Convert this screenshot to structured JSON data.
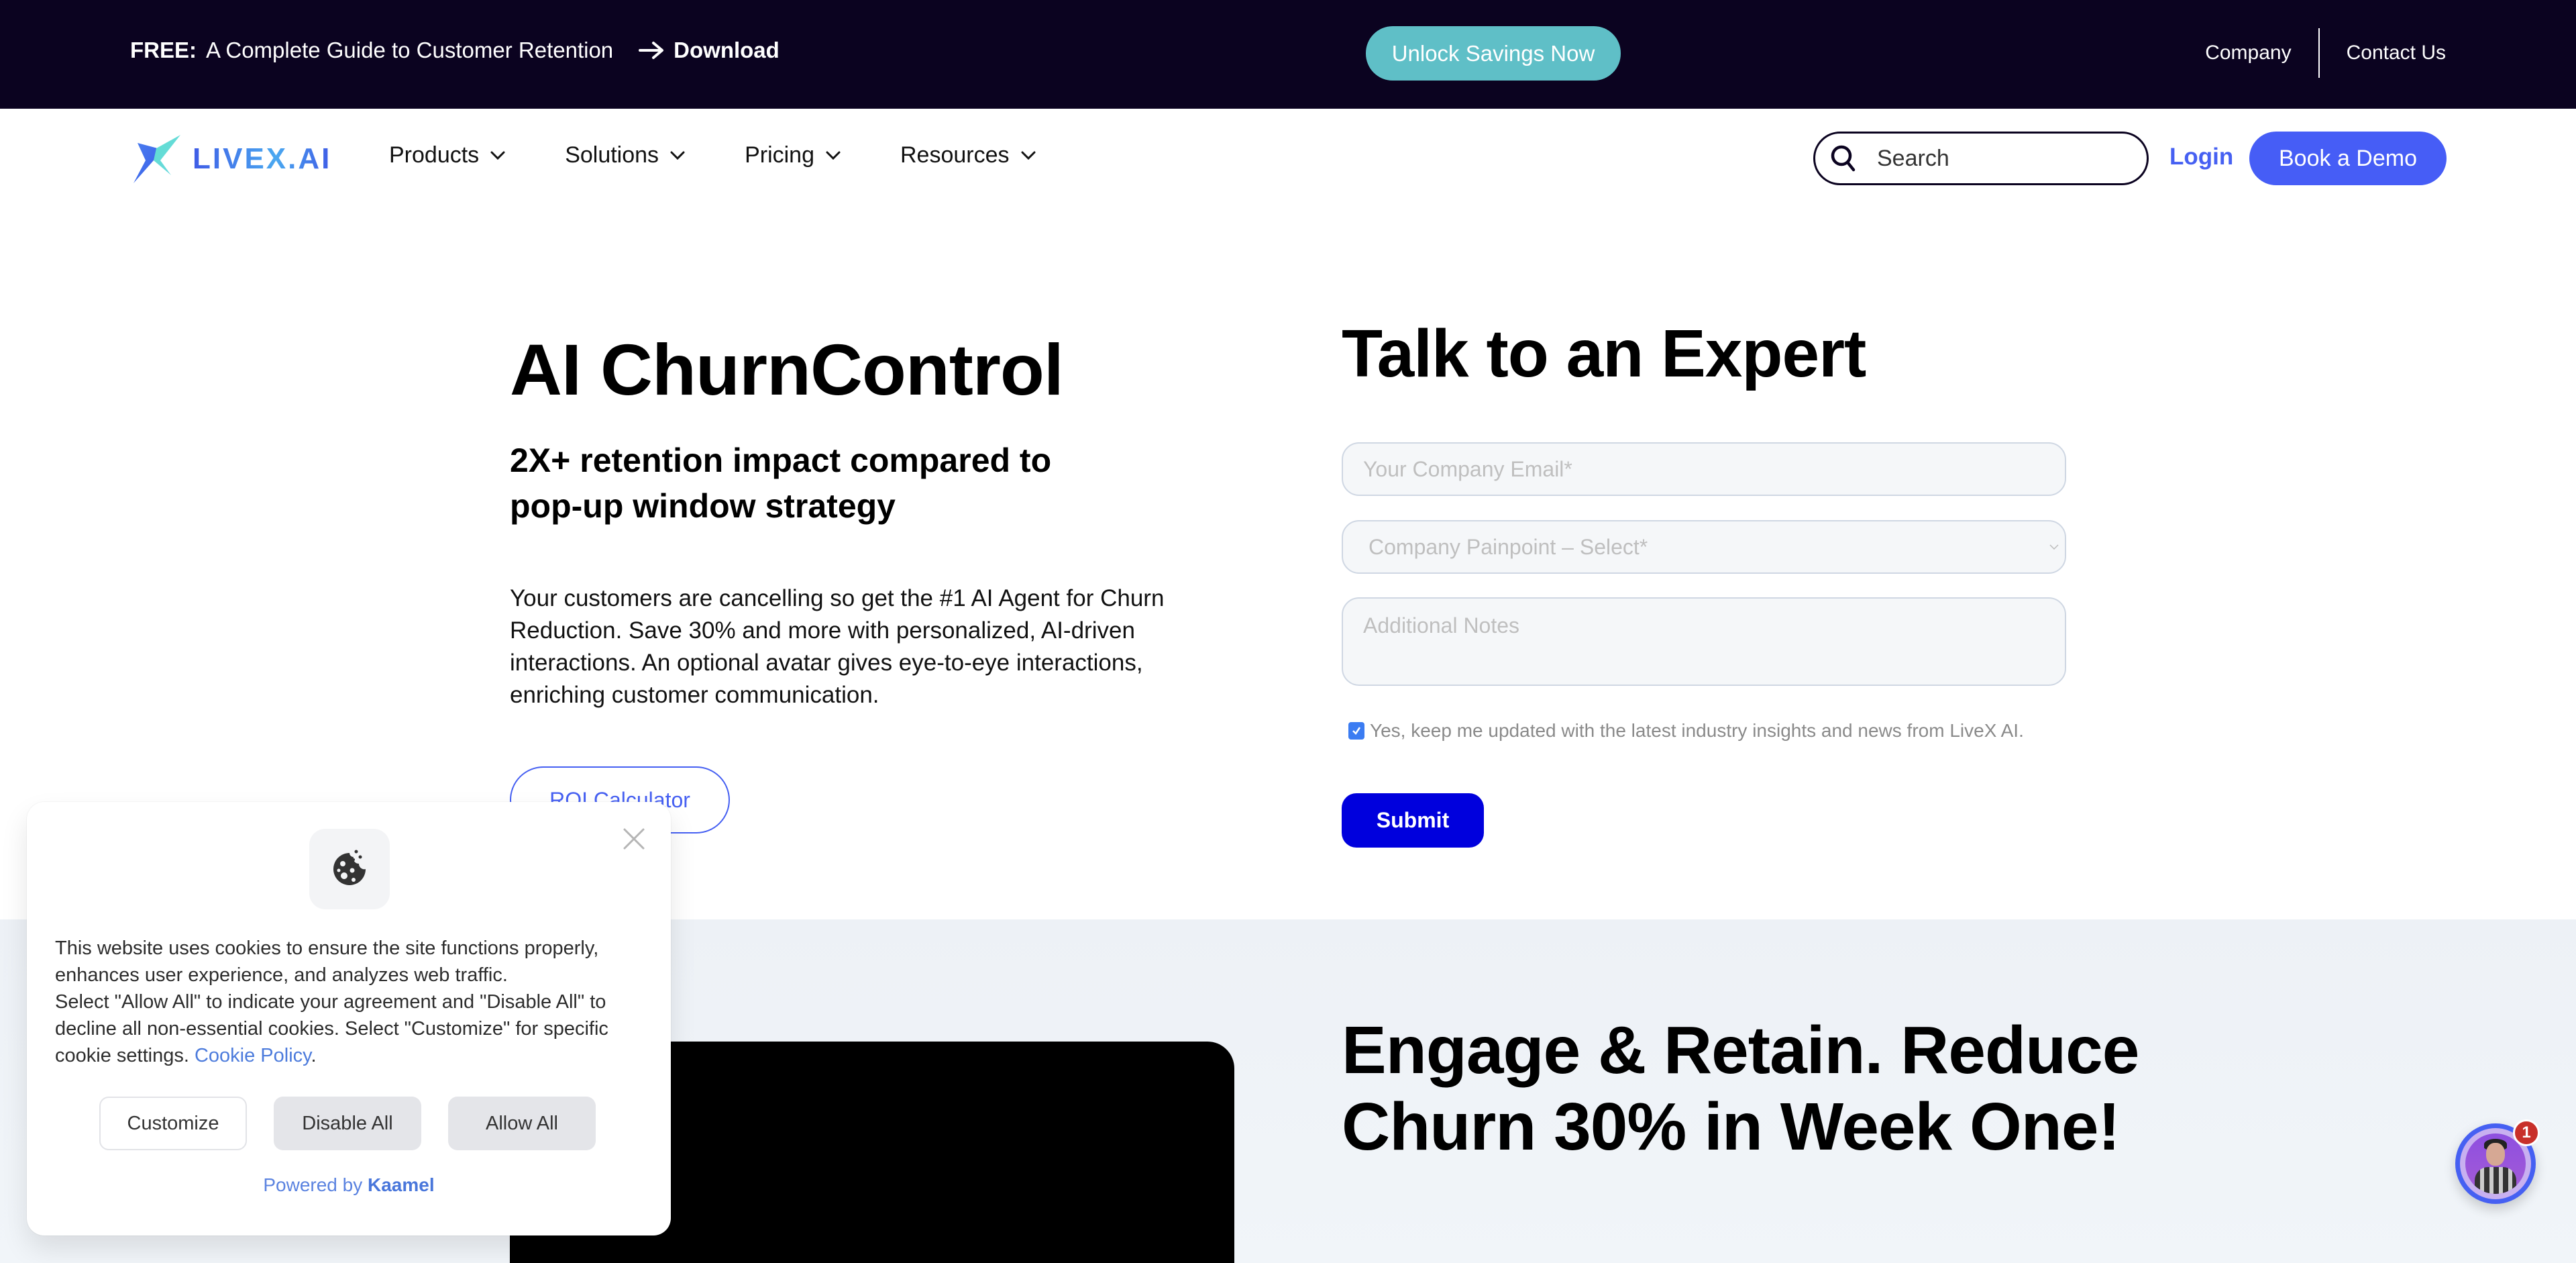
{
  "topbar": {
    "free_label": "FREE:",
    "promo_text": "A Complete Guide to Customer Retention",
    "download_label": "Download",
    "unlock_label": "Unlock Savings Now",
    "company_label": "Company",
    "contact_label": "Contact Us"
  },
  "nav": {
    "logo_text": "LIVEX.AI",
    "items": [
      {
        "label": "Products"
      },
      {
        "label": "Solutions"
      },
      {
        "label": "Pricing"
      },
      {
        "label": "Resources"
      }
    ],
    "search_placeholder": "Search",
    "login_label": "Login",
    "demo_label": "Book a Demo"
  },
  "hero": {
    "title": "AI ChurnControl",
    "subtitle": "2X+ retention impact compared to pop-up window strategy",
    "body": "Your customers are cancelling so get the #1 AI Agent for Churn Reduction. Save 30% and more with personalized, AI-driven interactions. An optional avatar gives eye-to-eye interactions, enriching customer communication.",
    "roi_label": "ROI Calculator"
  },
  "form": {
    "title": "Talk to an Expert",
    "email_placeholder": "Your Company Email*",
    "painpoint_selected": "Company Painpoint – Select*",
    "notes_placeholder": "Additional Notes",
    "consent_checked": true,
    "consent_label": "Yes, keep me updated with the latest industry insights and news from LiveX AI.",
    "submit_label": "Submit"
  },
  "lower": {
    "headline": "Engage & Retain. Reduce Churn 30% in Week One!"
  },
  "chat_widget": {
    "badge_count": "1"
  },
  "cookie": {
    "text_part1": "This website uses cookies to ensure the site functions properly, enhances user experience, and analyzes web traffic.",
    "text_part2": "Select \"Allow All\" to indicate your agreement and \"Disable All\" to decline all non-essential cookies. Select \"Customize\" for specific cookie settings.",
    "policy_link": "Cookie Policy",
    "customize_label": "Customize",
    "disable_label": "Disable All",
    "allow_label": "Allow All",
    "powered_by": "Powered by",
    "brand": "Kaamel"
  },
  "colors": {
    "topbar_bg": "#0b0320",
    "accent_blue": "#465df6",
    "unlock_teal": "#5fbfc7",
    "submit_blue": "#0000dd",
    "section_gray": "#edf1f6"
  }
}
